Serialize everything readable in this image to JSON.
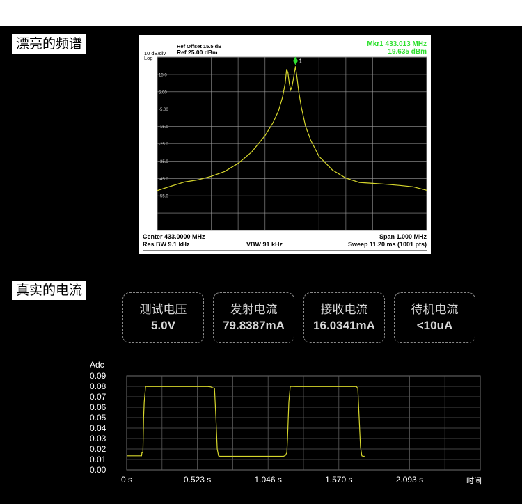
{
  "sections": {
    "spectrum_title": "漂亮的频谱",
    "current_title": "真实的电流"
  },
  "metrics": [
    {
      "label": "测试电压",
      "value": "5.0V"
    },
    {
      "label": "发射电流",
      "value": "79.8387mA"
    },
    {
      "label": "接收电流",
      "value": "16.0341mA"
    },
    {
      "label": "待机电流",
      "value": "<10uA"
    }
  ],
  "colors": {
    "trace": "#d6d62c",
    "marker": "#2fe02f",
    "grid": "#9a9a9a",
    "text": "#ffffff"
  },
  "chart_data": [
    {
      "type": "line",
      "header": {
        "ref_offset": "Ref Offset 15.5 dB",
        "ref_level": "Ref 25.00 dBm",
        "scale": "10 dB/div",
        "scale_type": "Log",
        "marker_name": "Mkr1 433.013 MHz",
        "marker_value": "19.635 dBm",
        "marker_label": "1"
      },
      "footer": {
        "center": "Center 433.0000 MHz",
        "span": "Span 1.000 MHz",
        "res_bw": "Res BW 9.1 kHz",
        "vbw": "VBW 91 kHz",
        "sweep": "Sweep  11.20 ms (1001 pts)"
      },
      "ytick_labels": [
        "15.0",
        "5.00",
        "-5.00",
        "-15.0",
        "-25.0",
        "-35.0",
        "-45.0",
        "-55.0"
      ],
      "xlim": [
        432.5,
        433.5
      ],
      "ylim": [
        -75,
        25
      ],
      "grid": true,
      "marker": {
        "x": 433.013,
        "y": 19.635
      },
      "series": [
        {
          "x": [
            432.5,
            432.55,
            432.6,
            432.65,
            432.7,
            432.75,
            432.8,
            432.85,
            432.9,
            432.93,
            432.95,
            432.965,
            432.975,
            432.98,
            432.985,
            432.99,
            432.995,
            433.0,
            433.005,
            433.01,
            433.013,
            433.018,
            433.025,
            433.035,
            433.05,
            433.07,
            433.1,
            433.15,
            433.2,
            433.25,
            433.3,
            433.35,
            433.4,
            433.45,
            433.5
          ],
          "y": [
            -52,
            -50,
            -48,
            -47,
            -45,
            -42,
            -37,
            -30,
            -20,
            -12,
            -5,
            2,
            10,
            18,
            16,
            10,
            6,
            8,
            12,
            17,
            19.6,
            14,
            5,
            -4,
            -14,
            -22,
            -31,
            -39,
            -44,
            -47,
            -48,
            -49,
            -50,
            -51,
            -53
          ]
        }
      ]
    },
    {
      "type": "line",
      "ylabel": "Adc",
      "xlabel": "时间",
      "yticks": [
        "0.09",
        "0.08",
        "0.07",
        "0.06",
        "0.05",
        "0.04",
        "0.03",
        "0.02",
        "0.01",
        "0.00"
      ],
      "xticks": [
        "0 s",
        "0.523 s",
        "1.046 s",
        "1.570 s",
        "2.093 s"
      ],
      "xlim": [
        0,
        2.616
      ],
      "ylim": [
        0,
        0.09
      ],
      "grid": true,
      "series": [
        {
          "x": [
            0,
            0.11,
            0.113,
            0.12,
            0.125,
            0.13,
            0.14,
            0.15,
            0.6,
            0.62,
            0.65,
            0.66,
            0.67,
            0.68,
            0.69,
            1.16,
            1.175,
            1.185,
            1.19,
            1.2,
            1.21,
            1.25,
            1.7,
            1.71,
            1.72,
            1.73,
            1.74,
            1.75,
            1.76
          ],
          "y": [
            0.0135,
            0.0135,
            0.0165,
            0.0165,
            0.05,
            0.065,
            0.08,
            0.0798,
            0.0798,
            0.0795,
            0.078,
            0.05,
            0.02,
            0.0135,
            0.013,
            0.013,
            0.014,
            0.0165,
            0.03,
            0.065,
            0.08,
            0.0798,
            0.0798,
            0.078,
            0.05,
            0.022,
            0.0135,
            0.013,
            0.013
          ]
        }
      ]
    }
  ]
}
